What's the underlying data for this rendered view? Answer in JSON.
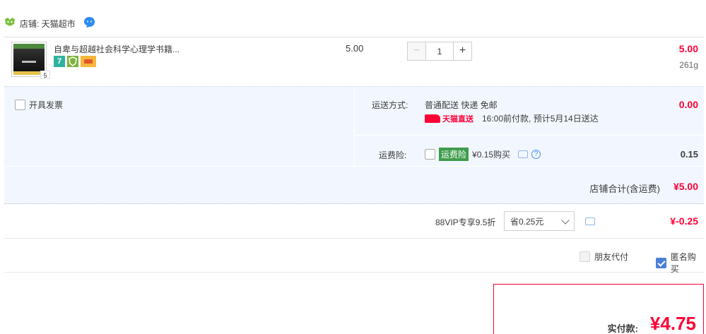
{
  "store": {
    "label": "店铺: 天猫超市",
    "icons": [
      "tmall-store-icon",
      "wangwang-chat-icon"
    ]
  },
  "item": {
    "title": "自卑与超越社会科学心理学书籍...",
    "tag_seven": "7",
    "tag_shield": "",
    "thumb_badge": "5",
    "unit_price": "5.00",
    "quantity": "1",
    "qty_minus": "−",
    "qty_plus": "+",
    "total": "5.00",
    "weight": "261g"
  },
  "extras": {
    "invoice_label": "开具发票",
    "shipping_label": "运送方式:",
    "shipping_method": "普通配送 快递 免邮",
    "tmall_direct": "天猫直送",
    "delivery_note": "16:00前付款, 预计5月14日送达",
    "shipping_fee": "0.00",
    "insurance_label": "运费险:",
    "insurance_tag": "运费险",
    "insurance_offer": "¥0.15购买",
    "insurance_help": "?",
    "insurance_price": "0.15",
    "store_total_label": "店铺合计(含运费)",
    "store_total_value": "¥5.00"
  },
  "vip": {
    "label": "88VIP专享9.5折",
    "select_value": "省0.25元",
    "discount": "¥-0.25"
  },
  "options": {
    "friend_pay": "朋友代付",
    "anonymous": "匿名购买",
    "anonymous_checked": true
  },
  "payment": {
    "label": "实付款:",
    "value": "¥4.75"
  },
  "colors": {
    "accent_red": "#ff0036",
    "panel_blue": "#f2f7ff",
    "check_blue": "#4a7fd6"
  }
}
